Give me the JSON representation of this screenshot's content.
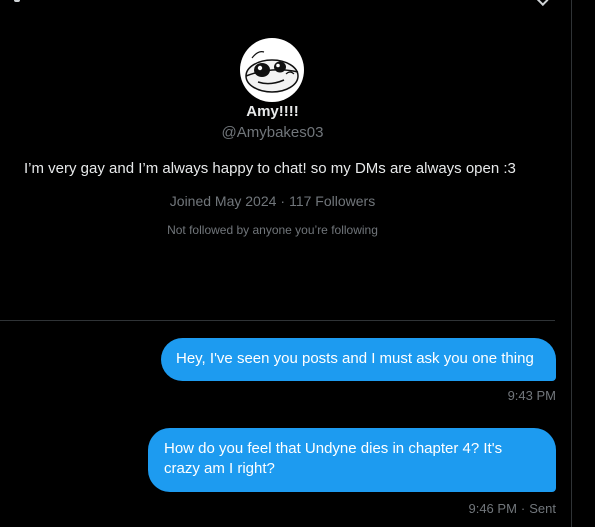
{
  "profile": {
    "display_name": "Amy!!!!",
    "handle": "@Amybakes03",
    "bio": "I’m very gay and I’m always happy to chat! so my DMs are always open :3",
    "joined": "Joined May 2024",
    "followers": "117 Followers",
    "separator": "·",
    "followed_by": "Not followed by anyone you’re following"
  },
  "messages": [
    {
      "text": "Hey, I've seen you posts and I must ask you one thing",
      "time": "9:43 PM"
    },
    {
      "text": "How do you feel that Undyne dies in chapter 4? It's crazy am I right?",
      "time": "9:46 PM",
      "status": "Sent",
      "separator": "·"
    }
  ],
  "colors": {
    "background": "#000000",
    "bubble": "#1d9bf0",
    "primary_text": "#e7e9ea",
    "secondary_text": "#71767b",
    "divider": "#2f3336"
  },
  "icons": {
    "avatar": "cartoon-face-avatar"
  }
}
